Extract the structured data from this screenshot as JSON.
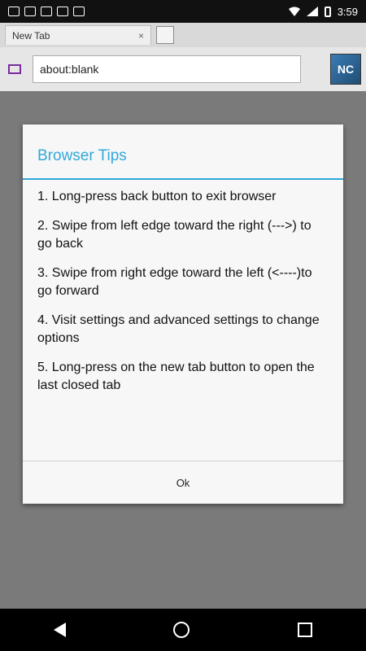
{
  "status_bar": {
    "time": "3:59"
  },
  "tab": {
    "title": "New Tab",
    "close": "×"
  },
  "url_bar": {
    "value": "about:blank"
  },
  "avatar": {
    "label": "NC"
  },
  "dialog": {
    "title": "Browser Tips",
    "tips": [
      "1. Long-press back button to exit browser",
      "2. Swipe from left edge toward the right (--->) to go back",
      "3. Swipe from right edge toward the left (<----)to go forward",
      "4. Visit settings and advanced settings to change options",
      "5. Long-press on the new tab button to open the last closed tab"
    ],
    "ok_label": "Ok"
  }
}
